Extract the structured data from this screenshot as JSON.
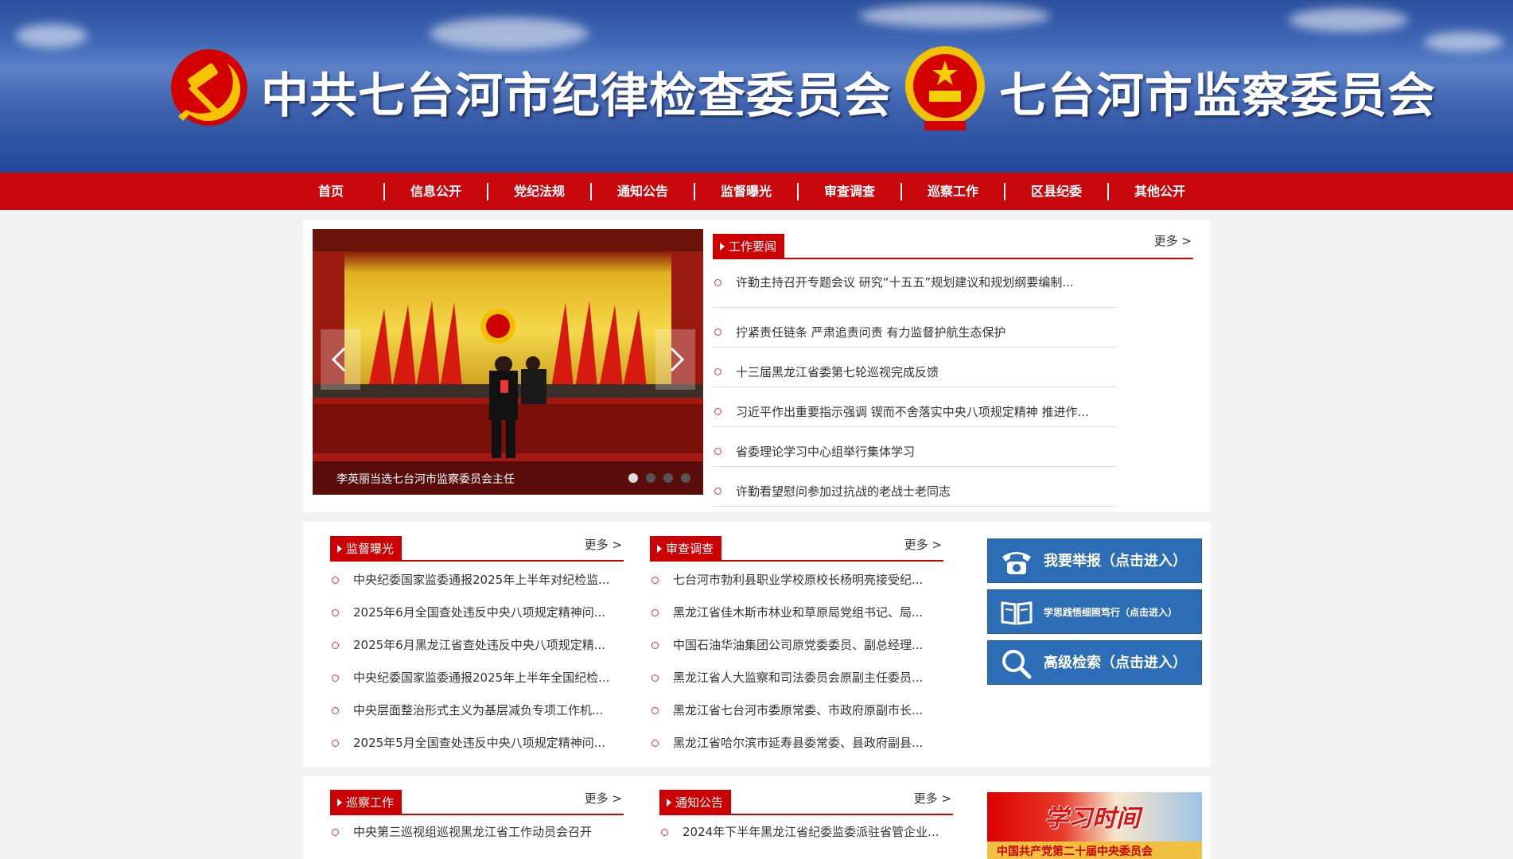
{
  "banner": {
    "left_title": "中共七台河市纪律检查委员会",
    "right_title": "七台河市监察委员会"
  },
  "nav": {
    "items": [
      "首页",
      "信息公开",
      "党纪法规",
      "通知公告",
      "监督曝光",
      "审查调查",
      "巡察工作",
      "区县纪委",
      "其他公开"
    ]
  },
  "slider": {
    "caption": "李英丽当选七台河市监察委员会主任",
    "slide_count": 4,
    "active_slide": 1
  },
  "work_news": {
    "title": "工作要闻",
    "more": "更多 >",
    "items": [
      "许勤主持召开专题会议 研究“十五五”规划建议和规划纲要编制...",
      "拧紧责任链条 严肃追责问责 有力监督护航生态保护",
      "十三届黑龙江省委第七轮巡视完成反馈",
      "习近平作出重要指示强调 锲而不舍落实中央八项规定精神 推进作...",
      "省委理论学习中心组举行集体学习",
      "许勤看望慰问参加过抗战的老战士老同志"
    ]
  },
  "supervision": {
    "title": "监督曝光",
    "more": "更多 >",
    "items": [
      "中央纪委国家监委通报2025年上半年对纪检监...",
      "2025年6月全国查处违反中央八项规定精神问...",
      "2025年6月黑龙江省查处违反中央八项规定精...",
      "中央纪委国家监委通报2025年上半年全国纪检...",
      "中央层面整治形式主义为基层减负专项工作机...",
      "2025年5月全国查处违反中央八项规定精神问..."
    ]
  },
  "investigation": {
    "title": "审查调查",
    "more": "更多 >",
    "items": [
      "七台河市勃利县职业学校原校长杨明亮接受纪...",
      "黑龙江省佳木斯市林业和草原局党组书记、局...",
      "中国石油华油集团公司原党委委员、副总经理...",
      "黑龙江省人大监察和司法委员会原副主任委员...",
      "黑龙江省七台河市委原常委、市政府原副市长...",
      "黑龙江省哈尔滨市延寿县委常委、县政府副县..."
    ]
  },
  "quick_links": {
    "report": "我要举报（点击进入）",
    "study": "学思践悟细照笃行（点击进入）",
    "search": "高级检索（点击进入）"
  },
  "inspection": {
    "title": "巡察工作",
    "more": "更多 >",
    "items": [
      "中央第三巡视组巡视黑龙江省工作动员会召开"
    ]
  },
  "notice": {
    "title": "通知公告",
    "more": "更多 >",
    "items": [
      "2024年下半年黑龙江省纪委监委派驻省管企业..."
    ]
  },
  "study_banner": {
    "title": "学习时间",
    "subtitle": "中国共产党第二十届中央委员会"
  }
}
